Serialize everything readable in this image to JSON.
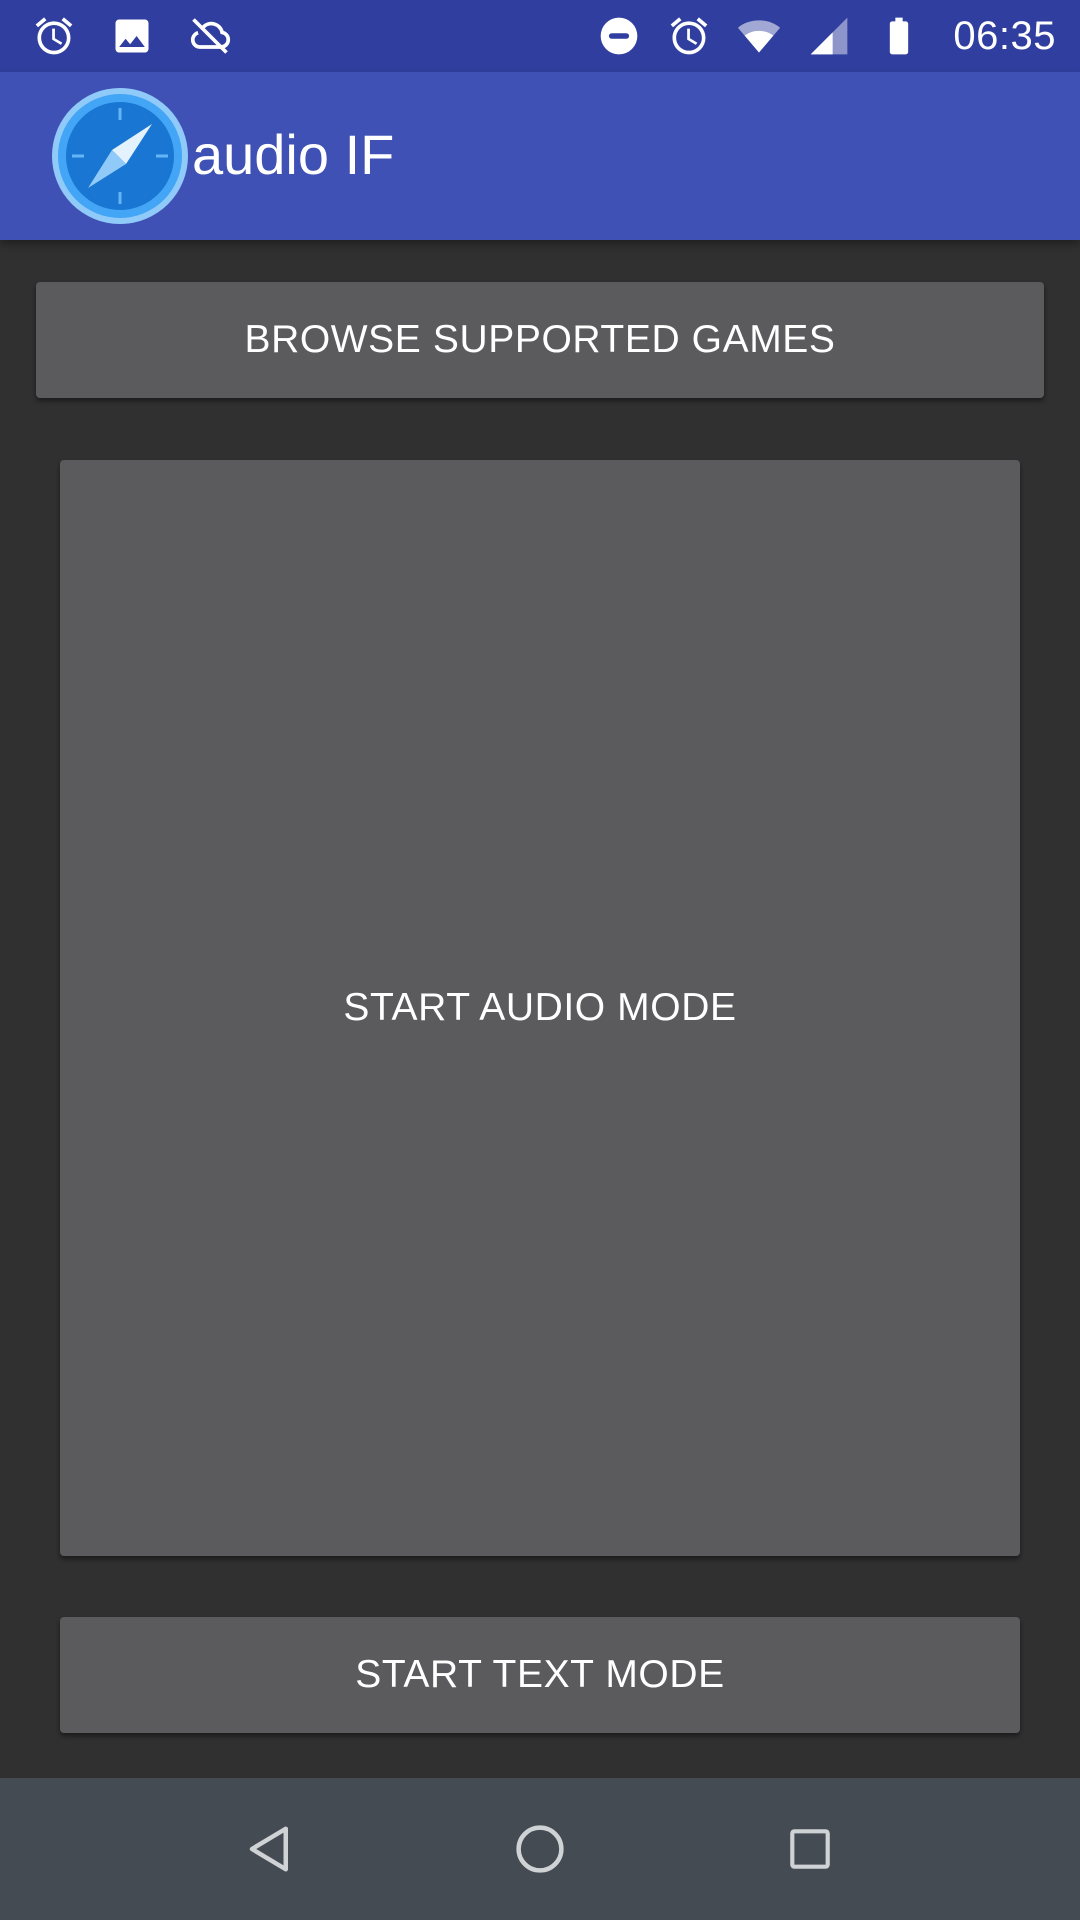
{
  "status_bar": {
    "time": "06:35",
    "left_icons": [
      "alarm-icon",
      "image-icon",
      "sync-off-icon"
    ],
    "right_icons": [
      "do-not-disturb-icon",
      "alarm-icon",
      "wifi-icon",
      "signal-icon",
      "battery-icon"
    ]
  },
  "app_bar": {
    "title": "audio IF",
    "logo_icon": "compass-icon"
  },
  "buttons": {
    "browse_label": "BROWSE SUPPORTED GAMES",
    "audio_label": "START AUDIO MODE",
    "text_label": "START TEXT MODE"
  },
  "nav_bar": {
    "icons": [
      "back-icon",
      "home-icon",
      "recent-apps-icon"
    ]
  },
  "colors": {
    "status_bar": "#303f9f",
    "app_bar": "#3f51b5",
    "background": "#303030",
    "button": "#5b5b5d",
    "nav_bar": "#444b52"
  }
}
